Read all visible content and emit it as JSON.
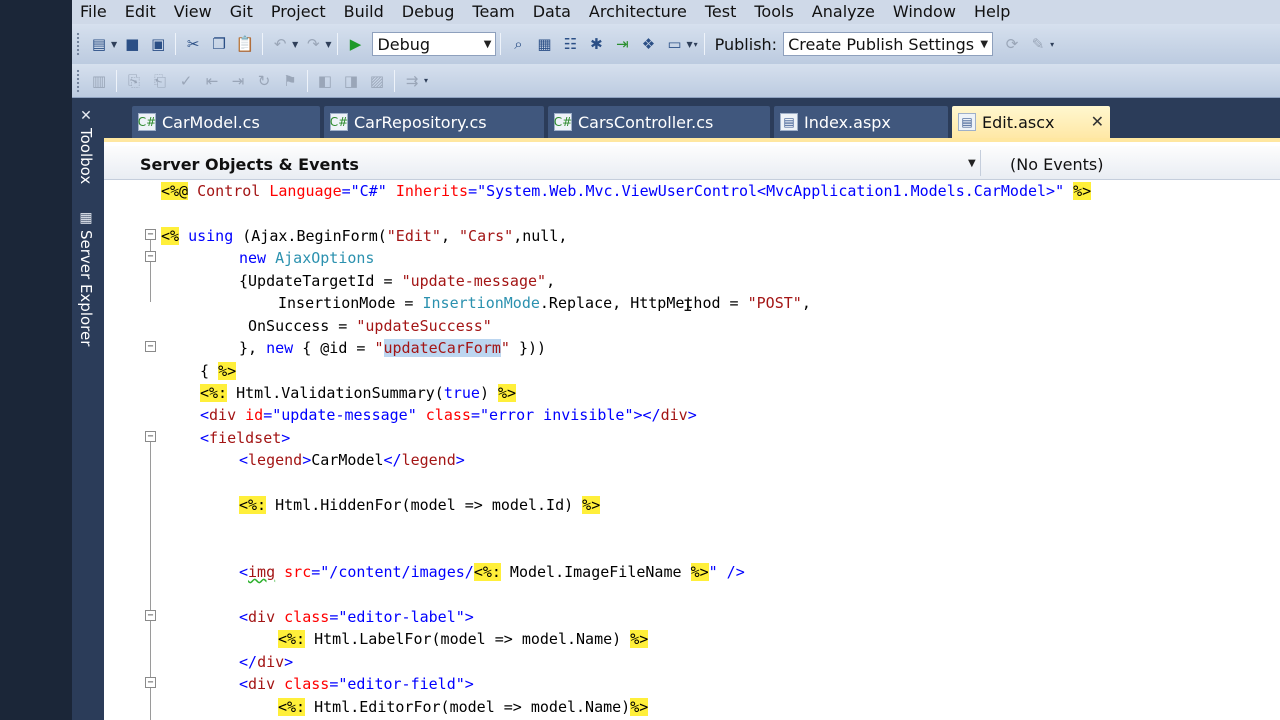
{
  "menu": [
    "File",
    "Edit",
    "View",
    "Git",
    "Project",
    "Build",
    "Debug",
    "Team",
    "Data",
    "Architecture",
    "Test",
    "Tools",
    "Analyze",
    "Window",
    "Help"
  ],
  "toolbar": {
    "config_value": "Debug",
    "publish_label": "Publish:",
    "publish_value": "Create Publish Settings"
  },
  "side_tabs": {
    "toolbox": "Toolbox",
    "server_explorer": "Server Explorer"
  },
  "tabs": [
    {
      "label": "CarModel.cs"
    },
    {
      "label": "CarRepository.cs"
    },
    {
      "label": "CarsController.cs"
    },
    {
      "label": "Index.aspx"
    },
    {
      "label": "Edit.ascx"
    }
  ],
  "navbar": {
    "left": "Server Objects & Events",
    "right": "(No Events)"
  },
  "code": {
    "l1": {
      "delim_open": "<%@",
      "word_control": "Control",
      "attr_language": "Language",
      "eq1": "=",
      "val_language": "\"C#\"",
      "attr_inherits": "Inherits",
      "eq2": "=",
      "val_inherits": "\"System.Web.Mvc.ViewUserControl<MvcApplication1.Models.CarModel>\"",
      "delim_close": "%>"
    },
    "l2": {
      "delim_open": "<%",
      "kw_using": "using",
      "text_a": "(Ajax.BeginForm(",
      "str_edit": "\"Edit\"",
      "comma1": ", ",
      "str_cars": "\"Cars\"",
      "text_b": ",null,"
    },
    "l3": {
      "kw_new": "new",
      "type_ajaxoptions": "AjaxOptions"
    },
    "l4": {
      "text_a": "{UpdateTargetId = ",
      "str_msg": "\"update-message\"",
      "text_b": ","
    },
    "l5": {
      "text_a": "InsertionMode = ",
      "type_insertionmode": "InsertionMode",
      "text_b": ".Replace, HttpMethod = ",
      "str_post": "\"POST\"",
      "text_c": ","
    },
    "l6": {
      "text_a": "OnSuccess = ",
      "str_success": "\"updateSuccess\""
    },
    "l7": {
      "text_a": "}, ",
      "kw_new": "new",
      "text_b": " { @id = ",
      "quote1": "\"",
      "sel_text": "updateCarForm",
      "quote2": "\"",
      "text_c": " }))"
    },
    "l8": {
      "text_a": "{ ",
      "delim_close": "%>"
    },
    "l9": {
      "delim_open": "<%:",
      "text_a": " Html.ValidationSummary(",
      "kw_true": "true",
      "text_b": ") ",
      "delim_close": "%>"
    },
    "l10": {
      "lt": "<",
      "tag_div": "div",
      "attr_id": " id",
      "eq1": "=",
      "val_id": "\"update-message\"",
      "attr_class": " class",
      "eq2": "=",
      "val_class": "\"error invisible\"",
      "close": "></",
      "tag_div2": "div",
      "gt": ">"
    },
    "l11": {
      "lt": "<",
      "tag": "fieldset",
      "gt": ">"
    },
    "l12": {
      "lt": "<",
      "tag": "legend",
      "gt": ">",
      "text": "CarModel",
      "lt2": "</",
      "tag2": "legend",
      "gt2": ">"
    },
    "l13": {
      "delim_open": "<%:",
      "text": " Html.HiddenFor(model => model.Id) ",
      "delim_close": "%>"
    },
    "l14": {
      "lt": "<",
      "tag": "img",
      "attr_src": " src",
      "eq": "=",
      "val_a": "\"/content/images/",
      "delim_open": "<%:",
      "text": " Model.ImageFileName ",
      "delim_close": "%>",
      "val_b": "\"",
      "end": " />"
    },
    "l15": {
      "lt": "<",
      "tag": "div",
      "attr_class": " class",
      "eq": "=",
      "val": "\"editor-label\"",
      "gt": ">"
    },
    "l16": {
      "delim_open": "<%:",
      "text": " Html.LabelFor(model => model.Name) ",
      "delim_close": "%>"
    },
    "l17": {
      "lt": "</",
      "tag": "div",
      "gt": ">"
    },
    "l18": {
      "lt": "<",
      "tag": "div",
      "attr_class": " class",
      "eq": "=",
      "val": "\"editor-field\"",
      "gt": ">"
    },
    "l19": {
      "delim_open": "<%:",
      "text": " Html.EditorFor(model => model.Name)",
      "delim_close": "%>"
    }
  },
  "colors": {
    "delimiter_bg": "#ffef3a",
    "keyword": "#0000ff",
    "type": "#2b91af",
    "string": "#a31515",
    "attribute": "#ff0000",
    "active_tab": "#ffe8a6"
  }
}
